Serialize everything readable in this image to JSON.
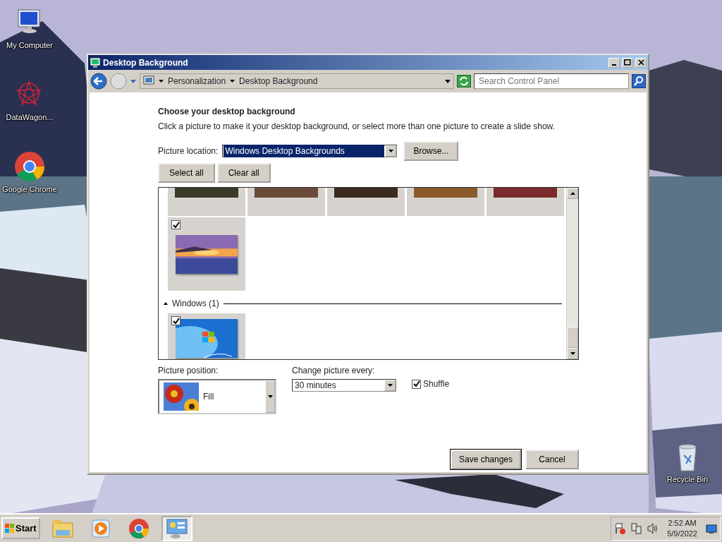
{
  "desktop_icons": [
    {
      "kind": "computer",
      "label": "My Computer"
    },
    {
      "kind": "star",
      "label": "DataWagon..."
    },
    {
      "kind": "chrome",
      "label": "Google Chrome"
    },
    {
      "kind": "bin",
      "label": "Recycle Bin"
    }
  ],
  "window": {
    "title": "Desktop Background"
  },
  "address_bar": {
    "crumbs": [
      "Personalization",
      "Desktop Background"
    ],
    "search": {
      "placeholder": "Search Control Panel"
    }
  },
  "heading": "Choose your desktop background",
  "description": "Click a picture to make it your desktop background, or select more than one picture to create a slide show.",
  "picture_location": {
    "label": "Picture location:",
    "value": "Windows Desktop Backgrounds",
    "browse": "Browse..."
  },
  "selection_buttons": [
    "Select all",
    "Clear all"
  ],
  "gallery": {
    "groups": [
      {
        "items": [
          {
            "kind": "cut"
          },
          {
            "kind": "cut"
          },
          {
            "kind": "cut"
          },
          {
            "kind": "cut"
          },
          {
            "kind": "cut"
          },
          {
            "kind": "tile",
            "checked": true
          }
        ]
      },
      {
        "title": "Windows (1)",
        "expanded": true,
        "items": [
          {
            "kind": "tile",
            "checked": true
          }
        ]
      }
    ]
  },
  "picture_position": {
    "label": "Picture position:",
    "value": "Fill"
  },
  "change_interval": {
    "label": "Change picture every:",
    "value": "30 minutes"
  },
  "shuffle": {
    "label": "Shuffle",
    "checked": true
  },
  "footer_buttons": [
    {
      "label": "Save changes",
      "default": true
    },
    {
      "label": "Cancel",
      "default": false
    }
  ],
  "taskbar": {
    "start": "Start",
    "apps": [
      {
        "kind": "folder",
        "selected": false
      },
      {
        "kind": "media",
        "selected": false
      },
      {
        "kind": "chrome",
        "selected": false
      },
      {
        "kind": "panel",
        "selected": true
      }
    ],
    "time": "2:52 AM",
    "date": "5/9/2022"
  }
}
